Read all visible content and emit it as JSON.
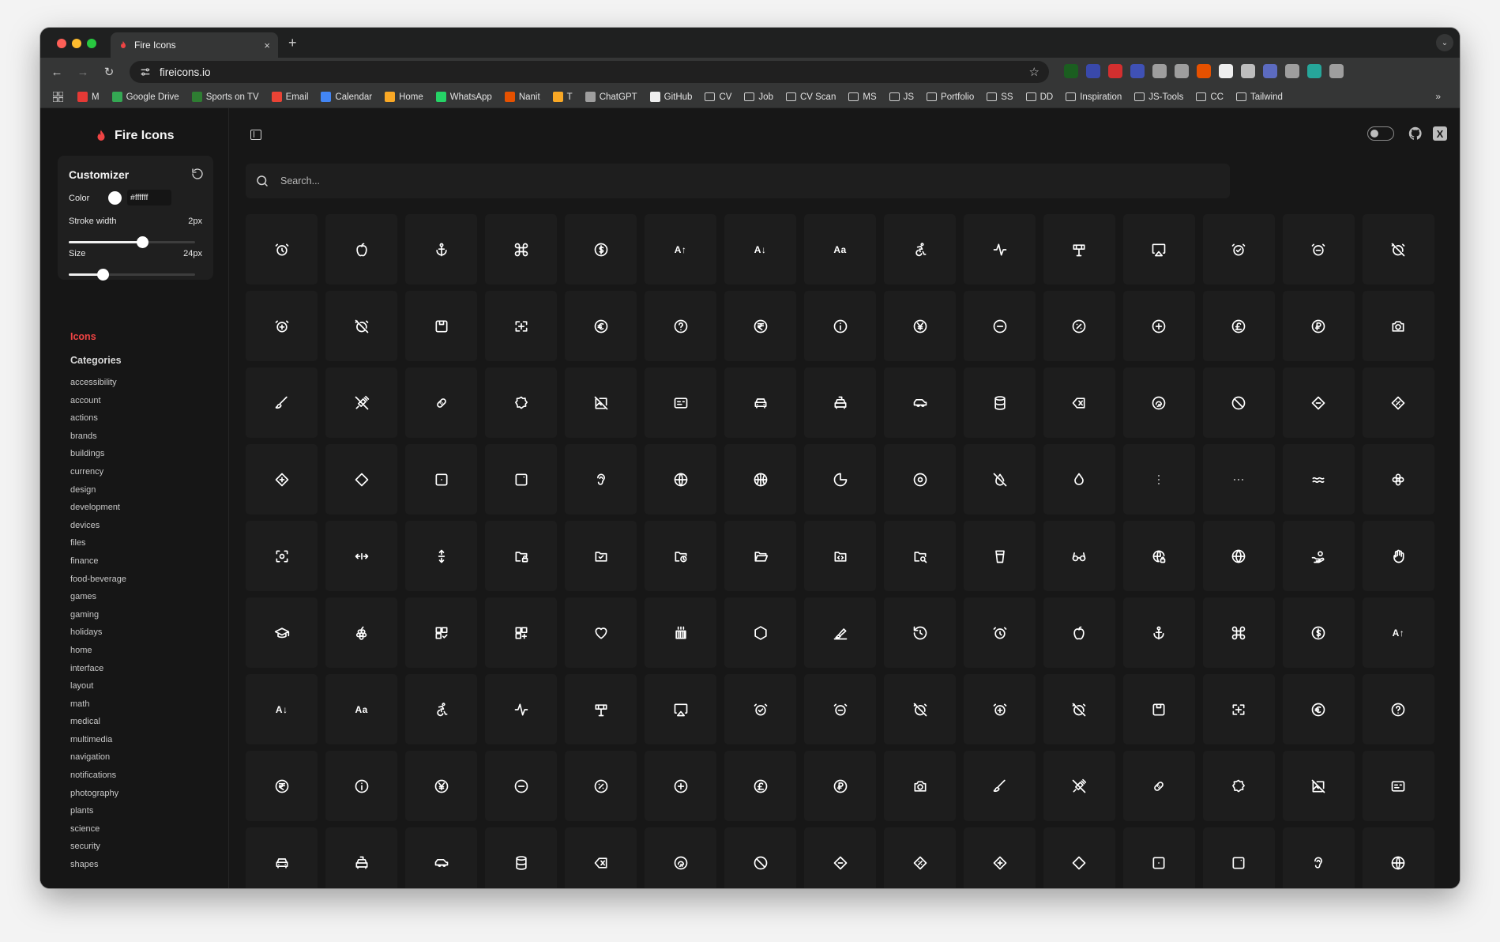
{
  "browser": {
    "tab_title": "Fire Icons",
    "tab_close": "×",
    "new_tab": "+",
    "url": "fireicons.io",
    "bookmarks": [
      {
        "label": "M",
        "kind": "app",
        "color": "#e53935"
      },
      {
        "label": "Google Drive",
        "kind": "app",
        "color": "#34a853"
      },
      {
        "label": "Sports on TV",
        "kind": "app",
        "color": "#2e7d32"
      },
      {
        "label": "Email",
        "kind": "app",
        "color": "#ea4335"
      },
      {
        "label": "Calendar",
        "kind": "app",
        "color": "#4285f4"
      },
      {
        "label": "Home",
        "kind": "app",
        "color": "#f9a825"
      },
      {
        "label": "WhatsApp",
        "kind": "app",
        "color": "#25d366"
      },
      {
        "label": "Nanit",
        "kind": "app",
        "color": "#e65100"
      },
      {
        "label": "T",
        "kind": "app",
        "color": "#f9a825"
      },
      {
        "label": "ChatGPT",
        "kind": "app",
        "color": "#9e9e9e"
      },
      {
        "label": "GitHub",
        "kind": "app",
        "color": "#eeeeee"
      },
      {
        "label": "CV",
        "kind": "folder"
      },
      {
        "label": "Job",
        "kind": "folder"
      },
      {
        "label": "CV Scan",
        "kind": "folder"
      },
      {
        "label": "MS",
        "kind": "folder"
      },
      {
        "label": "JS",
        "kind": "folder"
      },
      {
        "label": "Portfolio",
        "kind": "folder"
      },
      {
        "label": "SS",
        "kind": "folder"
      },
      {
        "label": "DD",
        "kind": "folder"
      },
      {
        "label": "Inspiration",
        "kind": "folder"
      },
      {
        "label": "JS-Tools",
        "kind": "folder"
      },
      {
        "label": "CC",
        "kind": "folder"
      },
      {
        "label": "Tailwind",
        "kind": "folder"
      }
    ],
    "bookmarks_more": "»",
    "extension_colors": [
      "#1b5e20",
      "#3949ab",
      "#d32f2f",
      "#3f51b5",
      "#9e9e9e",
      "#9e9e9e",
      "#e65100",
      "#eeeeee",
      "#bdbdbd",
      "#5c6bc0",
      "#9e9e9e",
      "#26a69a",
      "#9e9e9e"
    ]
  },
  "sidebar": {
    "brand": "Fire Icons",
    "brand_color": "#ef4444",
    "customizer": {
      "title": "Customizer",
      "color_label": "Color",
      "color_value": "#ffffff",
      "stroke_label": "Stroke width",
      "stroke_value": "2px",
      "stroke_fraction": 0.58,
      "size_label": "Size",
      "size_value": "24px",
      "size_fraction": 0.27
    },
    "nav_icons": "Icons",
    "nav_categories": "Categories",
    "categories": [
      "accessibility",
      "account",
      "actions",
      "brands",
      "buildings",
      "currency",
      "design",
      "development",
      "devices",
      "files",
      "finance",
      "food-beverage",
      "games",
      "gaming",
      "holidays",
      "home",
      "interface",
      "layout",
      "math",
      "medical",
      "multimedia",
      "navigation",
      "notifications",
      "photography",
      "plants",
      "science",
      "security",
      "shapes"
    ]
  },
  "main": {
    "search_placeholder": "Search...",
    "icons": [
      "alarm-clock",
      "apple",
      "anchor",
      "command",
      "dollar-circle",
      "text-increase",
      "text-decrease",
      "text-size",
      "accessibility",
      "activity",
      "signpost",
      "airplay",
      "alarm-check",
      "alarm-minus",
      "alarm-off",
      "alarm-plus",
      "alarm-off",
      "save-box",
      "grid-focus",
      "euro-circle",
      "help-circle",
      "rupee-circle",
      "info-circle",
      "yen-circle",
      "minus-circle",
      "percent-circle",
      "plus-circle",
      "pound-circle",
      "ruble-circle",
      "camera",
      "brush",
      "syringe-off",
      "bandage",
      "badge",
      "image-off",
      "id-card",
      "car-front",
      "taxi",
      "car-side",
      "database",
      "delete-back",
      "fingerprint-circle",
      "slash-circle",
      "diamond-minus",
      "diamond-percent",
      "diamond-plus",
      "diamond",
      "square-dot",
      "square-corner",
      "ear",
      "globe-half",
      "basketball",
      "pie-chart",
      "disc",
      "droplet-off",
      "droplet",
      "more-vertical",
      "more-horizontal",
      "approx",
      "flower",
      "focus",
      "move-horizontal",
      "move-vertical",
      "folder-lock",
      "folder-check",
      "folder-clock",
      "folder-open",
      "folder-code",
      "folder-search",
      "cup",
      "glasses",
      "globe-lock",
      "globe",
      "hand-coins",
      "hand",
      "graduation-cap",
      "grape",
      "grid-check",
      "grid-plus",
      "heart",
      "heater",
      "hexagon",
      "highlighter",
      "history",
      "alarm-clock",
      "apple",
      "anchor",
      "command",
      "dollar-circle",
      "text-increase",
      "text-decrease",
      "text-size",
      "accessibility",
      "activity",
      "signpost",
      "airplay",
      "alarm-check",
      "alarm-minus",
      "alarm-off",
      "alarm-plus",
      "alarm-off",
      "save-box",
      "grid-focus",
      "euro-circle",
      "help-circle",
      "rupee-circle",
      "info-circle",
      "yen-circle",
      "minus-circle",
      "percent-circle",
      "plus-circle",
      "pound-circle",
      "ruble-circle",
      "camera",
      "brush",
      "syringe-off",
      "bandage",
      "badge",
      "image-off",
      "id-card",
      "car-front",
      "taxi",
      "car-side",
      "database",
      "delete-back",
      "fingerprint-circle",
      "slash-circle",
      "diamond-minus",
      "diamond-percent",
      "diamond-plus",
      "diamond",
      "square-dot",
      "square-corner",
      "ear",
      "globe-half"
    ],
    "text_glyphs": {
      "text-increase": "A↑",
      "text-decrease": "A↓",
      "text-size": "Aa"
    }
  }
}
